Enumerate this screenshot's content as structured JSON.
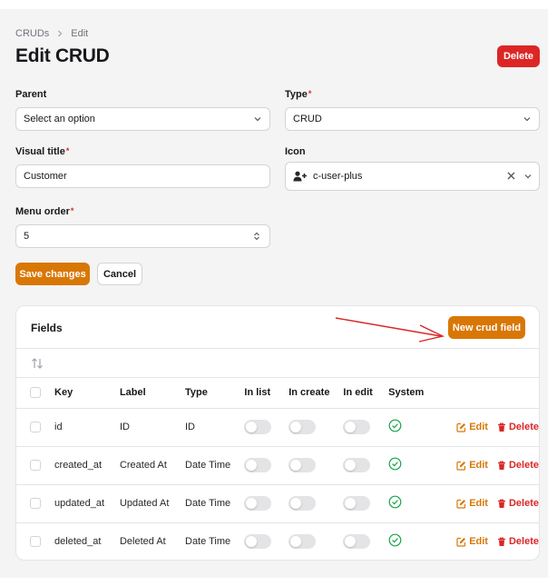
{
  "breadcrumb": {
    "parent": "CRUDs",
    "current": "Edit"
  },
  "page_title": "Edit CRUD",
  "delete_label": "Delete",
  "form": {
    "parent_label": "Parent",
    "parent_value": "Select an option",
    "type_label": "Type",
    "type_value": "CRUD",
    "visual_title_label": "Visual title",
    "visual_title_value": "Customer",
    "icon_label": "Icon",
    "icon_value": "c-user-plus",
    "menu_order_label": "Menu order",
    "menu_order_value": "5",
    "required_mark": "*"
  },
  "save_label": "Save changes",
  "cancel_label": "Cancel",
  "fields_card": {
    "title": "Fields",
    "new_button_label": "New crud field",
    "columns": [
      "Key",
      "Label",
      "Type",
      "In list",
      "In create",
      "In edit",
      "System"
    ],
    "rows": [
      {
        "key": "id",
        "label": "ID",
        "type": "ID"
      },
      {
        "key": "created_at",
        "label": "Created At",
        "type": "Date Time"
      },
      {
        "key": "updated_at",
        "label": "Updated At",
        "type": "Date Time"
      },
      {
        "key": "deleted_at",
        "label": "Deleted At",
        "type": "Date Time"
      }
    ],
    "edit_label": "Edit",
    "delete_label": "Delete"
  },
  "colors": {
    "primary": "#d97706",
    "danger": "#dc2626",
    "success": "#16a34a",
    "annotation_arrow": "#dc2626"
  },
  "icons": {
    "sort": "sort-arrows-icon",
    "system": "check-circle-icon",
    "icon_field": "user-plus-icon",
    "edit": "pencil-square-icon",
    "delete": "trash-icon"
  }
}
